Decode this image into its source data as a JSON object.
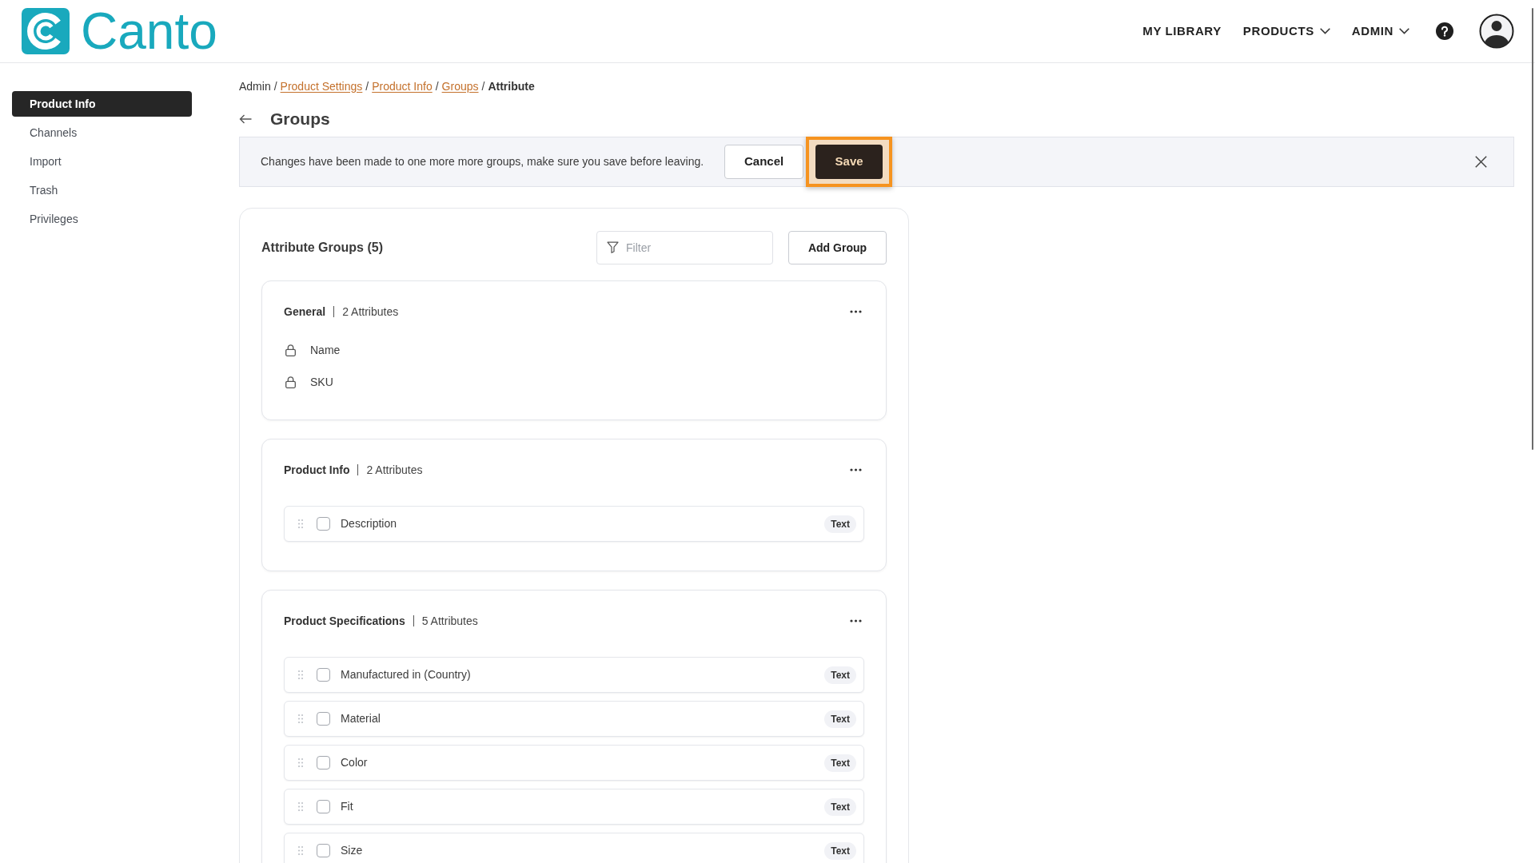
{
  "logo": {
    "wordmark": "Canto"
  },
  "nav": [
    {
      "label": "MY LIBRARY",
      "dropdown": false
    },
    {
      "label": "PRODUCTS",
      "dropdown": true
    },
    {
      "label": "ADMIN",
      "dropdown": true
    }
  ],
  "sidebar": {
    "items": [
      {
        "label": "Product Info",
        "selected": true
      },
      {
        "label": "Channels",
        "selected": false
      },
      {
        "label": "Import",
        "selected": false
      },
      {
        "label": "Trash",
        "selected": false
      },
      {
        "label": "Privileges",
        "selected": false
      }
    ]
  },
  "breadcrumb": [
    {
      "kind": "text",
      "label": "Admin"
    },
    {
      "kind": "separator",
      "label": "/"
    },
    {
      "kind": "link",
      "label": "Product Settings"
    },
    {
      "kind": "separator",
      "label": "/"
    },
    {
      "kind": "link",
      "label": "Product Info"
    },
    {
      "kind": "separator",
      "label": "/"
    },
    {
      "kind": "link",
      "label": "Groups"
    },
    {
      "kind": "separator",
      "label": "/"
    },
    {
      "kind": "current",
      "label": "Attribute"
    }
  ],
  "page_title": "Groups",
  "banner": {
    "message": "Changes have been made to one more more groups, make sure you save before leaving.",
    "buttons": [
      {
        "label": "Cancel",
        "kind": "secondary",
        "focused": false
      },
      {
        "label": "Save",
        "kind": "primary",
        "focused": true
      }
    ]
  },
  "attribute_groups": {
    "title": "Attribute Groups (5)",
    "filter": {
      "placeholder": "Filter"
    },
    "add_button": "Add Group",
    "groups": [
      {
        "name": "General",
        "count": "2 Attributes",
        "attributes": [
          {
            "kind": "locked",
            "name": "Name"
          },
          {
            "kind": "locked",
            "name": "SKU"
          }
        ]
      },
      {
        "name": "Product Info",
        "count": "2 Attributes",
        "attributes": [
          {
            "kind": "draggable",
            "name": "Description",
            "type": "Text",
            "checked": false
          }
        ]
      },
      {
        "name": "Product Specifications",
        "count": "5 Attributes",
        "attributes": [
          {
            "kind": "draggable",
            "name": "Manufactured in (Country)",
            "type": "Text",
            "checked": false
          },
          {
            "kind": "draggable",
            "name": "Material",
            "type": "Text",
            "checked": false
          },
          {
            "kind": "draggable",
            "name": "Color",
            "type": "Text",
            "checked": false
          },
          {
            "kind": "draggable",
            "name": "Fit",
            "type": "Text",
            "checked": false
          },
          {
            "kind": "draggable",
            "name": "Size",
            "type": "Text",
            "checked": false
          }
        ]
      }
    ]
  }
}
